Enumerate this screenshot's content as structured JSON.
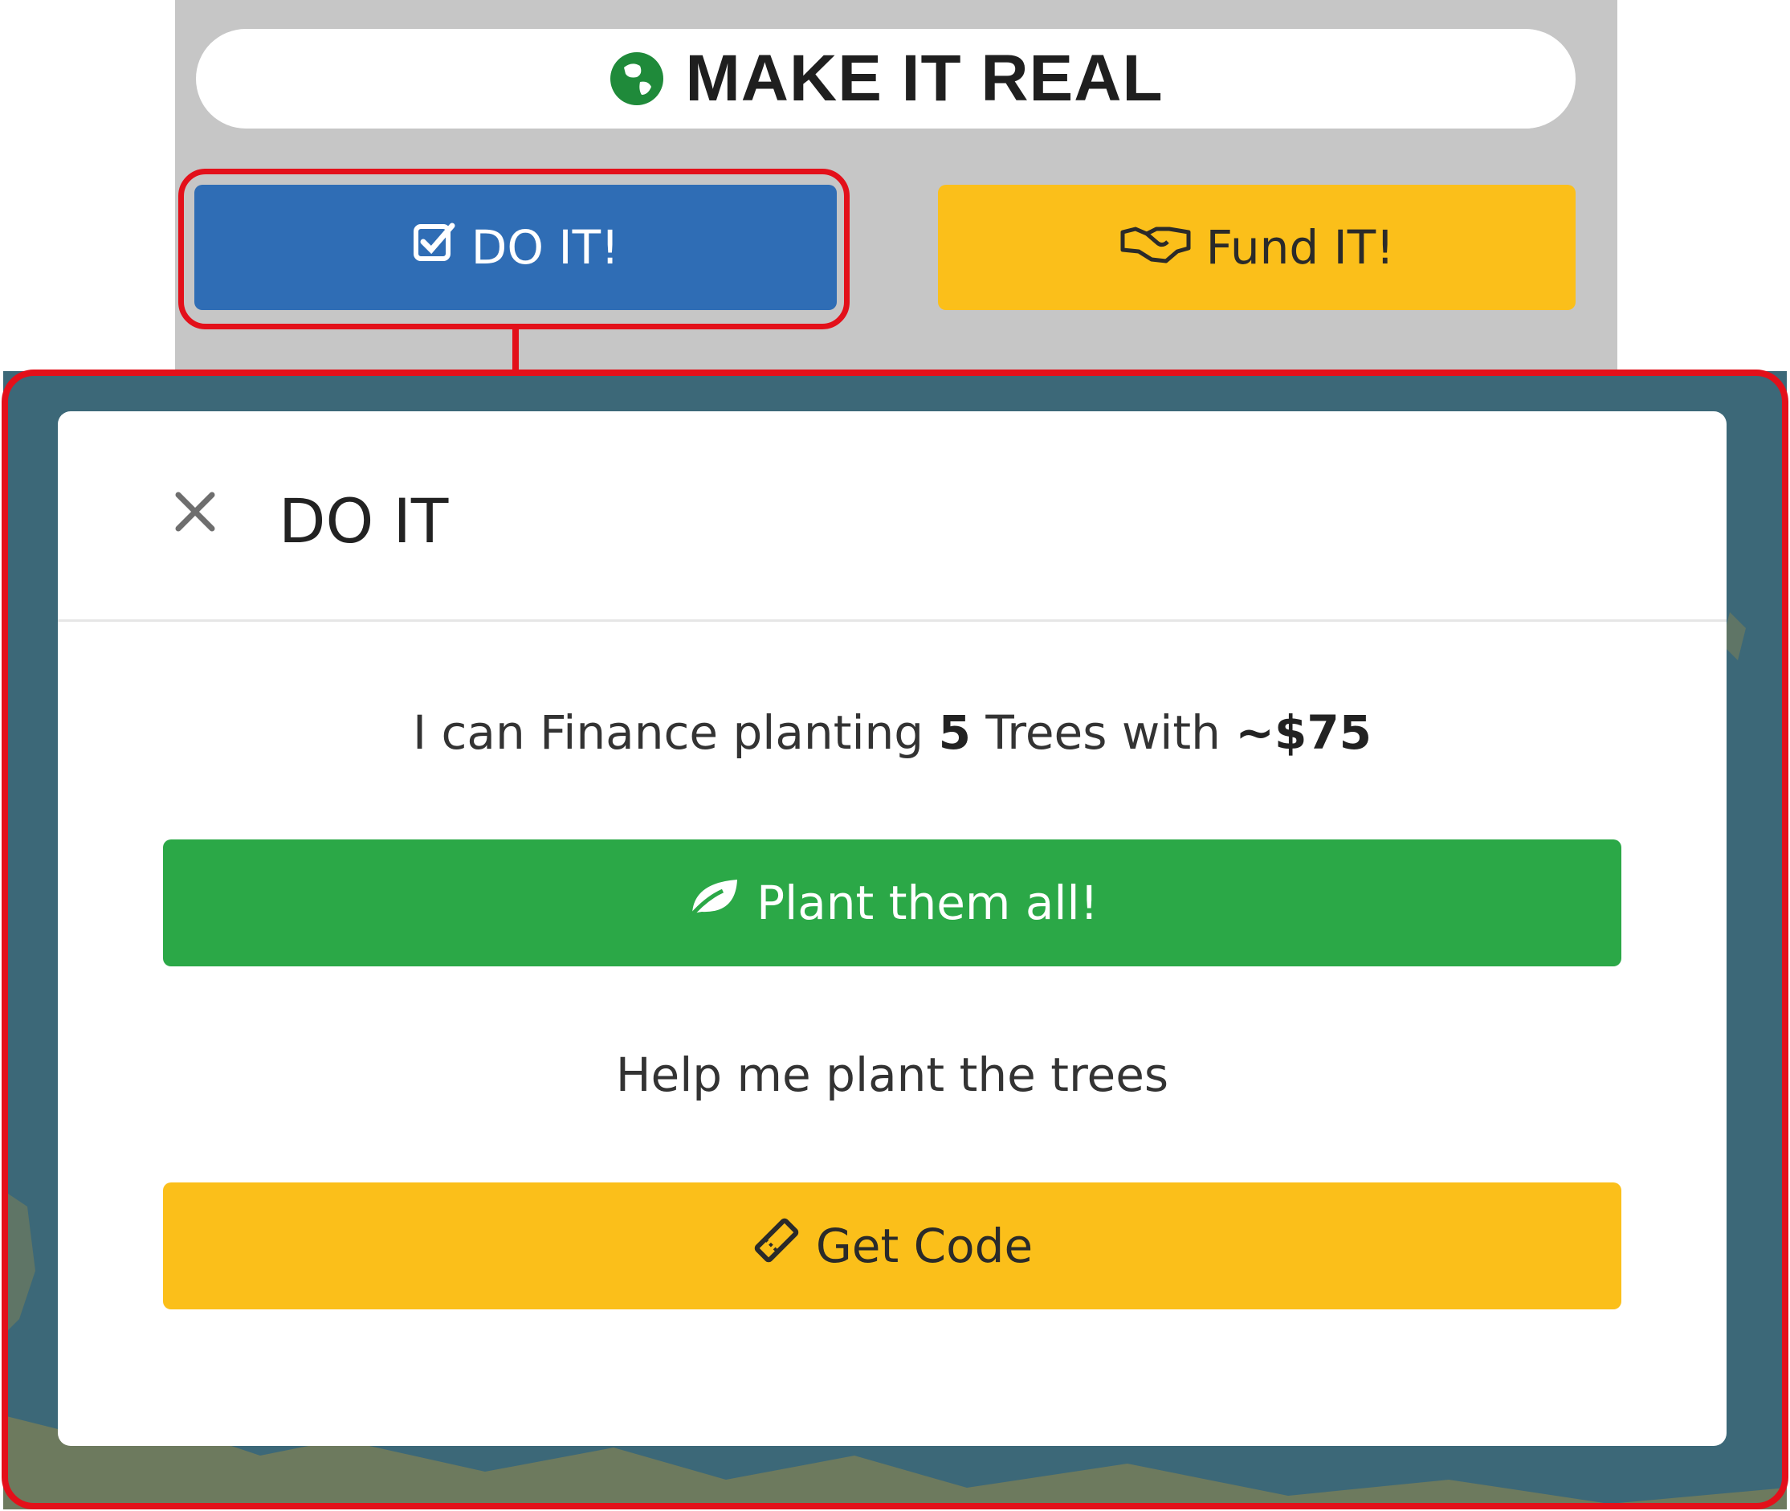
{
  "header": {
    "title": "MAKE IT REAL"
  },
  "buttons": {
    "do_it": "DO IT!",
    "fund_it": "Fund IT!"
  },
  "modal": {
    "title": "DO IT",
    "finance_prefix": "I can Finance planting ",
    "tree_count": "5",
    "finance_middle": " Trees with ",
    "amount": "~$75",
    "plant_label": "Plant them all!",
    "help_text": "Help me plant the trees",
    "code_label": "Get Code"
  },
  "icons": {
    "title": "globe-icon",
    "do_it": "check-square-icon",
    "fund_it": "handshake-icon",
    "close": "close-icon",
    "plant": "leaf-icon",
    "code": "ticket-icon"
  },
  "colors": {
    "do_it": "#2f6db5",
    "fund_it": "#fbbf1a",
    "plant": "#2ba847",
    "get_code": "#fbbf1a",
    "highlight": "#e3101a",
    "map_water": "#3c6878"
  }
}
